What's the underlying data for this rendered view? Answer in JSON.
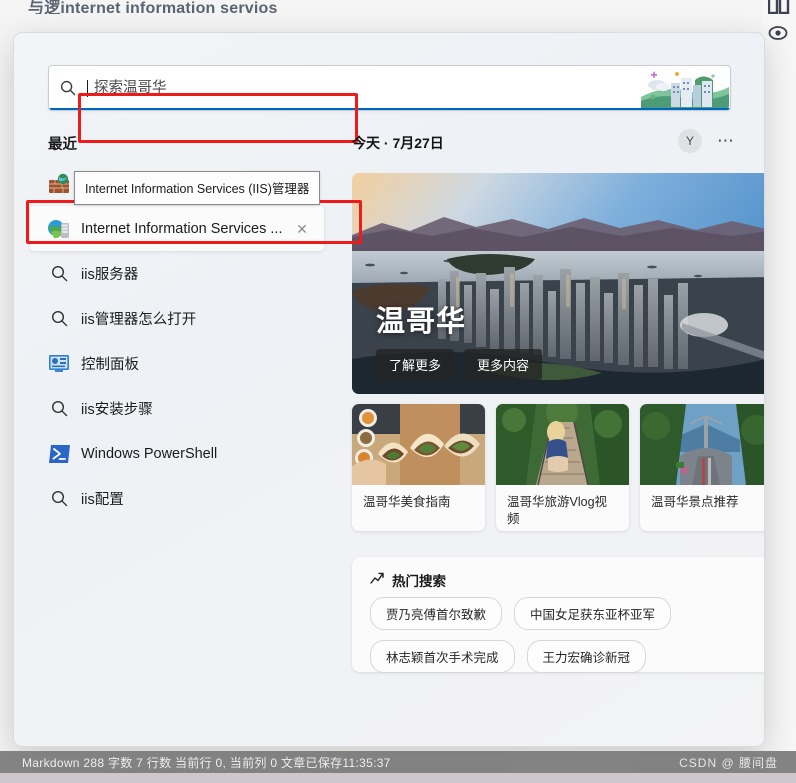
{
  "editor": {
    "top_text": "与逻internet information servios",
    "split_view_icon": "split-view-icon",
    "preview_icon": "eye-icon"
  },
  "search": {
    "icon": "search-icon",
    "placeholder": "探索温哥华",
    "value": "",
    "decoration_icon": "city-illustration-icon",
    "highlight_color": "#ee1b1b",
    "underline_color": "#0067c0"
  },
  "recent": {
    "heading": "最近",
    "tooltip": "Internet Information Services (IIS)管理器",
    "items": [
      {
        "label": "Internet Information Services (IIS)管理器",
        "icon": "iis-brick-icon",
        "selected": false,
        "hidden_by_tooltip": true
      },
      {
        "label": "Internet Information Services ...",
        "icon": "iis-manager-icon",
        "selected": true,
        "close_label": "✕"
      },
      {
        "label": "iis服务器",
        "icon": "search-icon",
        "selected": false
      },
      {
        "label": "iis管理器怎么打开",
        "icon": "search-icon",
        "selected": false
      },
      {
        "label": "控制面板",
        "icon": "control-panel-icon",
        "selected": false
      },
      {
        "label": "iis安装步骤",
        "icon": "search-icon",
        "selected": false
      },
      {
        "label": "Windows PowerShell",
        "icon": "powershell-icon",
        "selected": false
      },
      {
        "label": "iis配置",
        "icon": "search-icon",
        "selected": false
      }
    ]
  },
  "content": {
    "date_label": "今天 · 7月27日",
    "avatar_initial": "Y",
    "more_icon": "ellipsis-icon",
    "hero": {
      "title": "温哥华",
      "image": "vancouver-aerial-skyline-photo",
      "buttons": [
        "了解更多",
        "更多内容"
      ]
    },
    "cards": [
      {
        "caption": "温哥华美食指南",
        "image": "vancouver-tacos-food-photo"
      },
      {
        "caption": "温哥华旅游Vlog视频",
        "image": "suspension-bridge-photo"
      },
      {
        "caption": "温哥华景点推荐",
        "image": "lions-gate-bridge-photo"
      }
    ],
    "trending": {
      "icon": "trending-arrow-icon",
      "heading": "热门搜索",
      "chips": [
        "贾乃亮傅首尔致歉",
        "中国女足获东亚杯亚军",
        "林志颖首次手术完成",
        "王力宏确诊新冠"
      ]
    }
  },
  "statusbar": {
    "left_text": "Markdown  288 字数  7 行数  当前行 0, 当前列 0  文章已保存11:35:37",
    "watermark": "CSDN @  腰间盘"
  }
}
